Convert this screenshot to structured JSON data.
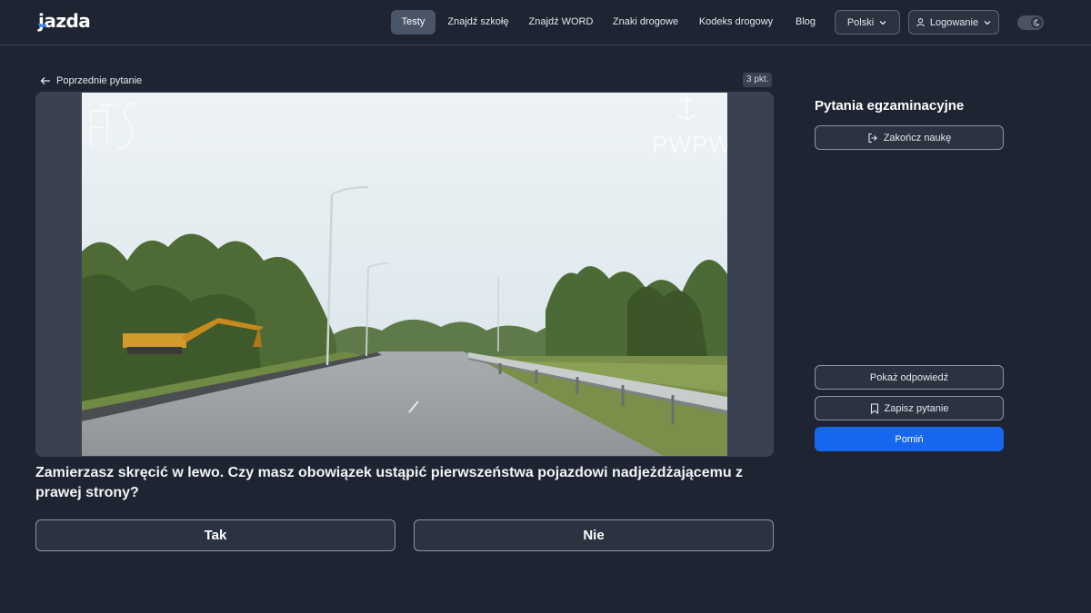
{
  "nav": {
    "logo": "jazda",
    "links": [
      {
        "label": "Testy",
        "active": true
      },
      {
        "label": "Znajdź szkołę",
        "active": false
      },
      {
        "label": "Znajdź WORD",
        "active": false
      },
      {
        "label": "Znaki drogowe",
        "active": false
      },
      {
        "label": "Kodeks drogowy",
        "active": false
      },
      {
        "label": "Blog",
        "active": false
      }
    ],
    "language": "Polski",
    "login": "Logowanie",
    "theme_toggle_icon": "moon-icon"
  },
  "question_panel": {
    "back_label": "Poprzednie pytanie",
    "points": "3 pkt.",
    "watermarks": [
      "PWPW"
    ],
    "question_text": "Zamierzasz skręcić w lewo. Czy masz obowiązek ustąpić pierwszeństwa pojazdowi nadjeżdżającemu z prawej strony?",
    "answers": [
      "Tak",
      "Nie"
    ]
  },
  "sidebar": {
    "title": "Pytania egzaminacyjne",
    "finish_label": "Zakończ naukę",
    "show_answer_label": "Pokaż odpowiedź",
    "save_label": "Zapisz pytanie",
    "skip_label": "Pomiń"
  },
  "colors": {
    "background": "#1e2432",
    "accent": "#1766ee",
    "panel": "#3a4252"
  }
}
